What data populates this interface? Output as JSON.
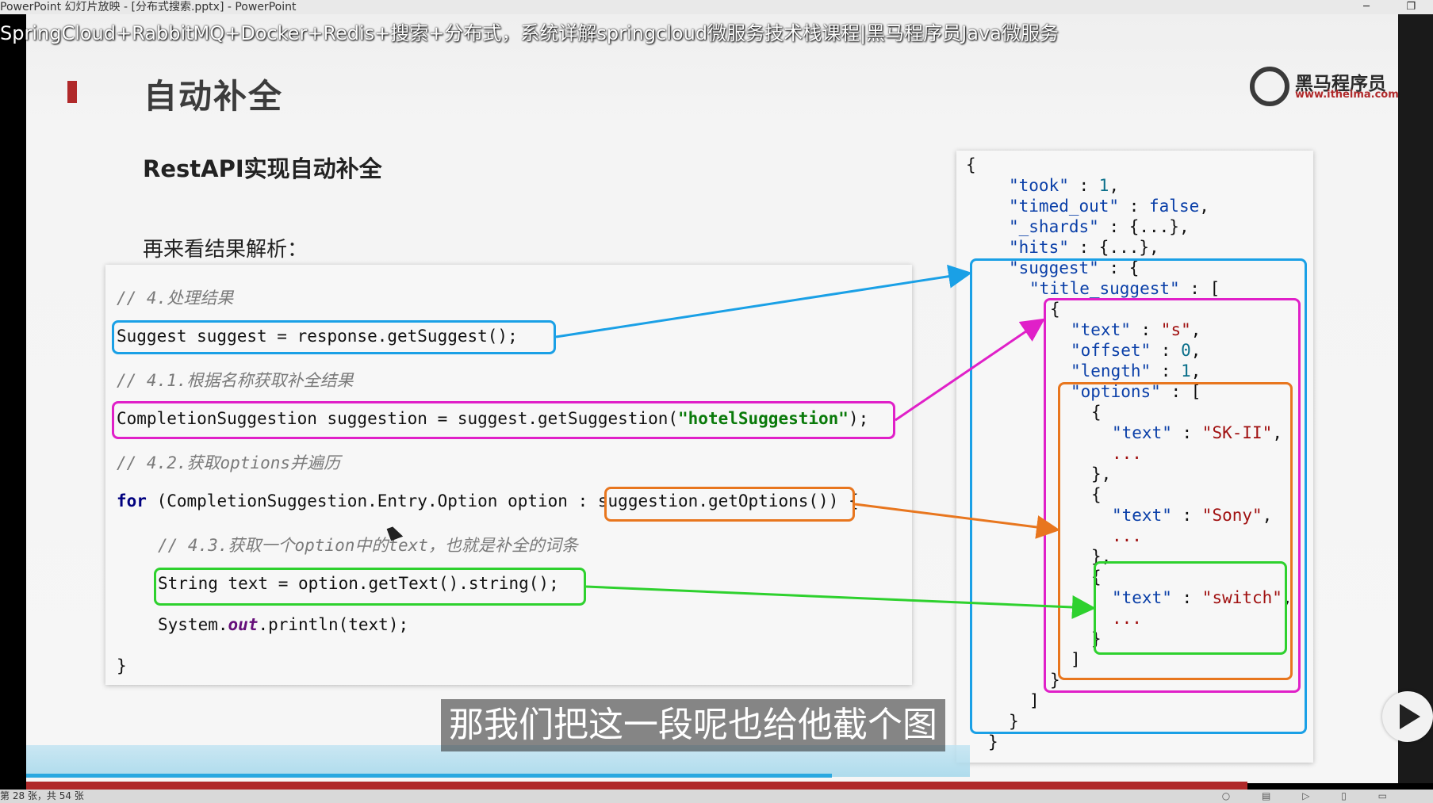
{
  "window": {
    "title": "PowerPoint 幻灯片放映 - [分布式搜索.pptx] - PowerPoint",
    "minimize_glyph": "─",
    "restore_glyph": "❐"
  },
  "video_overlay_title": "SpringCloud+RabbitMQ+Docker+Redis+搜索+分布式，系统详解springcloud微服务技术栈课程|黑马程序员Java微服务",
  "slide": {
    "title": "自动补全",
    "subtitle": "RestAPI实现自动补全",
    "lead": "再来看结果解析：",
    "logo_main": "黑马程序员",
    "logo_url": "www.itheima.com"
  },
  "code": {
    "c1": "// 4.处理结果",
    "l1": "Suggest suggest = response.getSuggest();",
    "c2": "// 4.1.根据名称获取补全结果",
    "l2a": "CompletionSuggestion suggestion = suggest.getSuggestion(",
    "l2s": "\"hotelSuggestion\"",
    "l2b": ");",
    "c3": "// 4.2.获取options并遍历",
    "l3kw": "for",
    "l3a": " (CompletionSuggestion.Entry.Option option : ",
    "l3b": "suggestion.getOptions()",
    "l3c": ") {",
    "c4": "// 4.3.获取一个option中的text，也就是补全的词条",
    "l4": "String text = option.getText().string();",
    "l5a": "System.",
    "l5out": "out",
    "l5b": ".println(text);",
    "l6": "}"
  },
  "json": {
    "open": "{",
    "took_k": "\"took\"",
    "took_v": "1",
    "timed_k": "\"timed_out\"",
    "timed_v": "false",
    "shards_k": "\"_shards\"",
    "shards_v": "{...}",
    "hits_k": "\"hits\"",
    "hits_v": "{...}",
    "suggest_k": "\"suggest\"",
    "ts_k": "\"title_suggest\"",
    "text_k": "\"text\"",
    "text_v": "\"s\"",
    "offset_k": "\"offset\"",
    "offset_v": "0",
    "length_k": "\"length\"",
    "length_v": "1",
    "options_k": "\"options\"",
    "o1_v": "\"SK-II\"",
    "o2_v": "\"Sony\"",
    "o3_v": "\"switch\"",
    "ellipsis": "...",
    "close": "}"
  },
  "caption": "那我们把这一段呢也给他截个图",
  "status": {
    "slide_counter": "第 28 张，共 54 张"
  },
  "colors": {
    "blue": "#1aa0e6",
    "magenta": "#e020c8",
    "orange": "#e8761e",
    "green": "#2ed12e",
    "brand_red": "#b0292a"
  },
  "playback_progress_percent": 66
}
